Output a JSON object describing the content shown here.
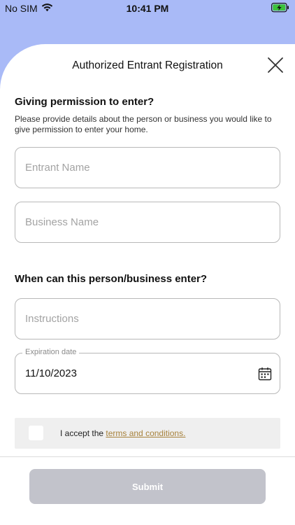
{
  "status_bar": {
    "carrier": "No SIM",
    "time": "10:41 PM"
  },
  "header": {
    "title": "Authorized Entrant Registration"
  },
  "section_permission": {
    "title": "Giving permission to enter?",
    "description": "Please provide details about the person or business you would like to give permission to enter your home."
  },
  "fields": {
    "entrant_name": {
      "placeholder": "Entrant Name",
      "value": ""
    },
    "business_name": {
      "placeholder": "Business Name",
      "value": ""
    },
    "instructions": {
      "placeholder": "Instructions",
      "value": ""
    },
    "expiration_date": {
      "label": "Expiration date",
      "value": "11/10/2023"
    }
  },
  "section_when": {
    "title": "When can this person/business enter?"
  },
  "terms": {
    "prefix": "I accept the ",
    "link_text": "terms and conditions.",
    "checked": false
  },
  "submit": {
    "label": "Submit",
    "enabled": false
  },
  "colors": {
    "background_accent": "#a9baf7",
    "link": "#a7823c",
    "submit_disabled": "#c2c3cb",
    "battery_charging": "#3cc23c"
  },
  "icons": {
    "wifi": "wifi-icon",
    "battery": "battery-charging-icon",
    "close": "close-icon",
    "calendar": "calendar-icon"
  }
}
